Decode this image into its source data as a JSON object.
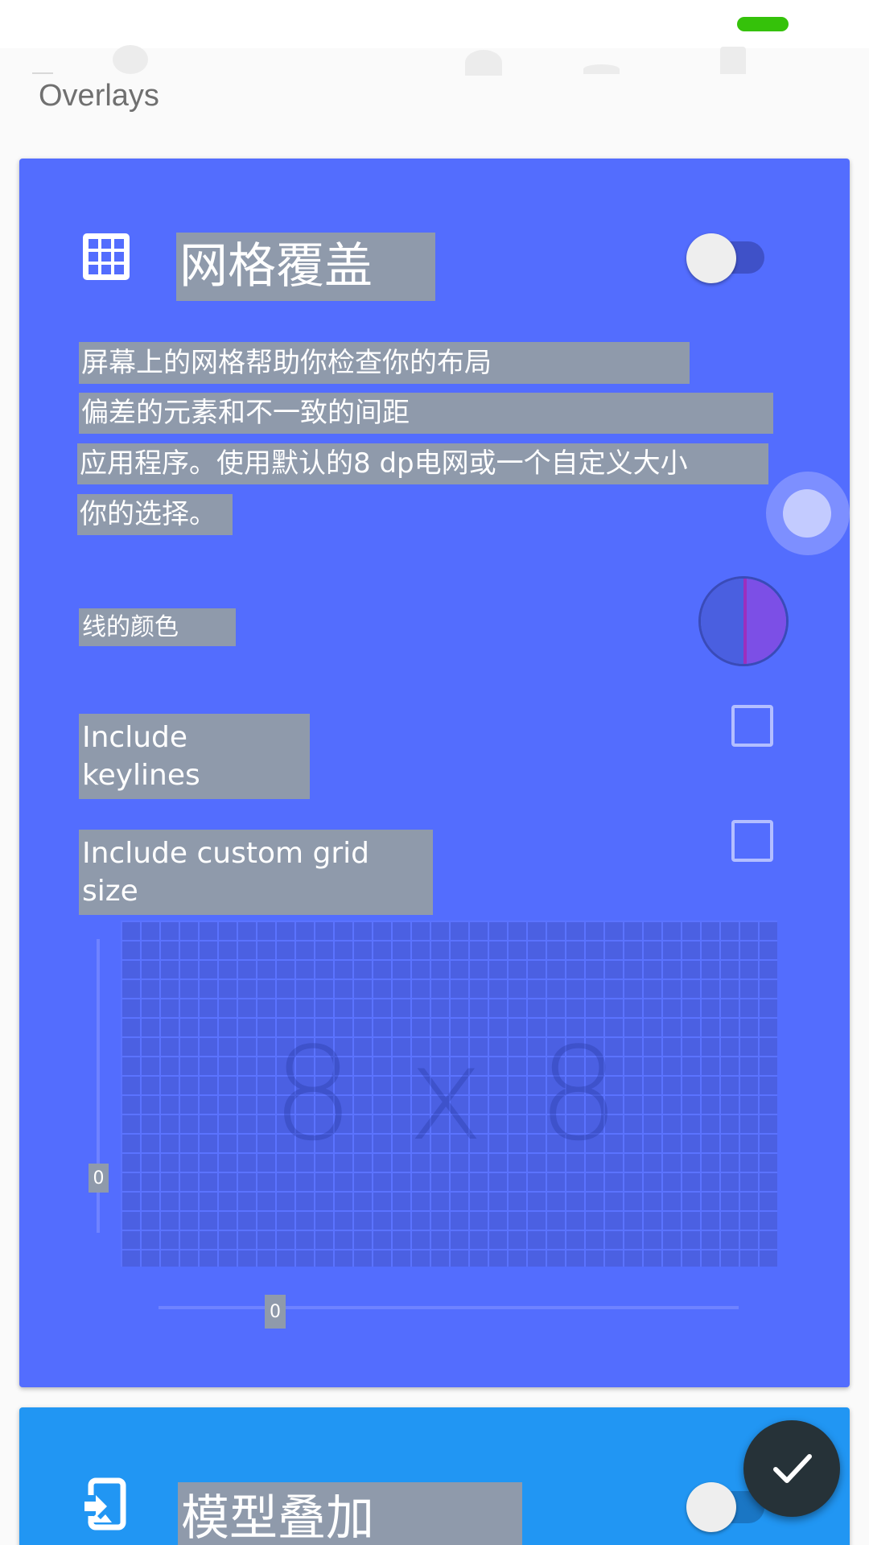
{
  "screen": {
    "section_title": "Overlays"
  },
  "grid_overlay": {
    "title": "网格覆盖",
    "enabled": false,
    "description_lines": [
      "屏幕上的网格帮助你检查你的布局",
      "偏差的元素和不一致的间距",
      "应用程序。使用默认的8 dp电网或一个自定义大小",
      "你的选择。"
    ],
    "line_color_label": "线的颜色",
    "line_colors": [
      "#4a5fe0",
      "#7c4fe6"
    ],
    "keylines_label": "Include\nkeylines",
    "keylines_checked": false,
    "custom_size_label": "Include custom grid\nsize",
    "custom_size_checked": false,
    "preview_label": "8 x 8",
    "vertical_slider_value": "0",
    "horizontal_slider_value": "0"
  },
  "mockup_overlay": {
    "title": "模型叠加",
    "enabled": false
  },
  "icons": {
    "grid": "grid-icon",
    "mockup": "image-into-phone-icon",
    "fab": "check-icon"
  },
  "colors": {
    "card_primary": "#536dfe",
    "card_secondary": "#2196f3",
    "fab": "#263238",
    "status_indicator": "#35c20a"
  }
}
